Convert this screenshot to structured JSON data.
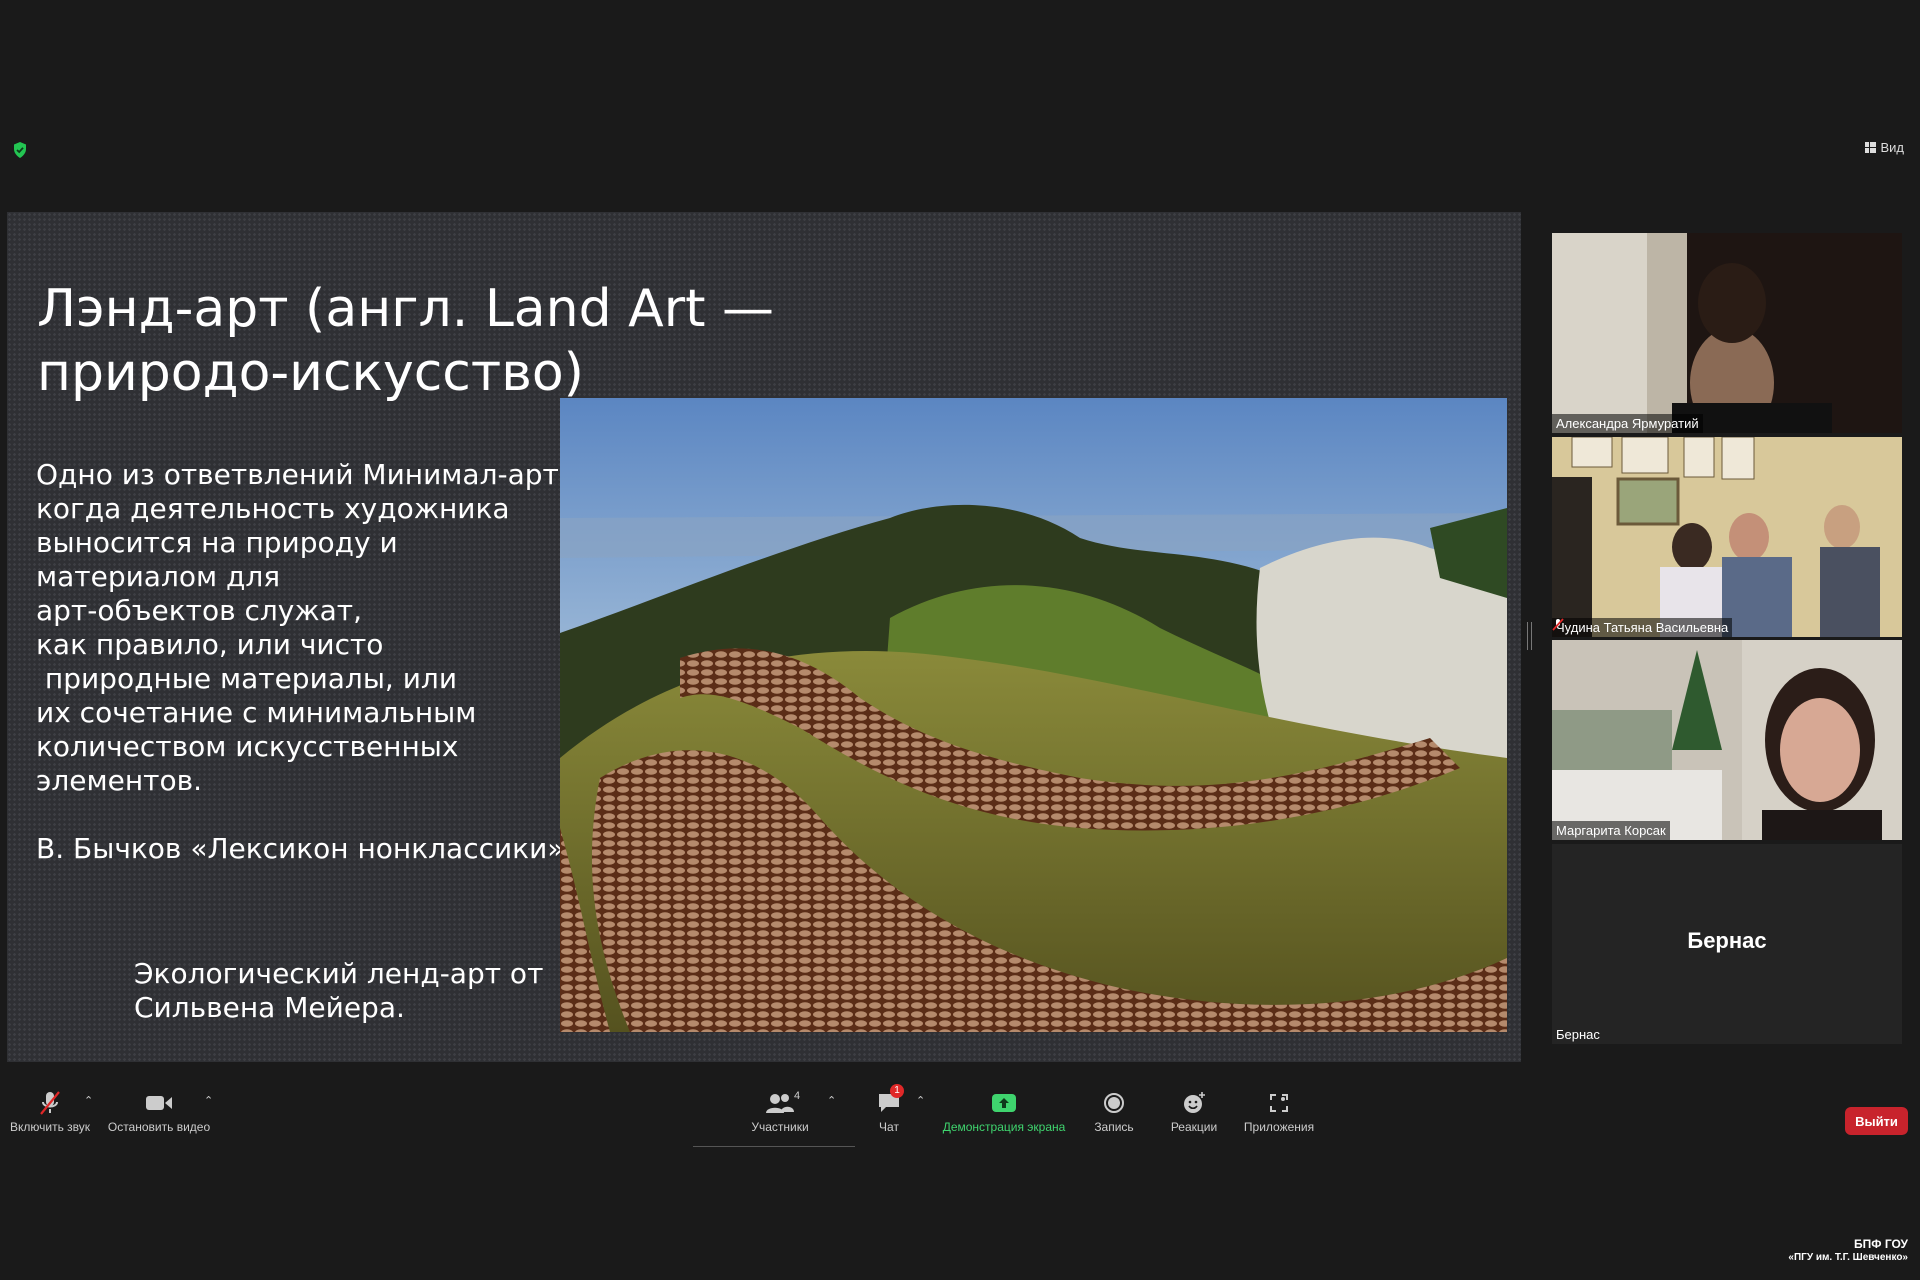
{
  "window": {
    "view_label": "Вид"
  },
  "slide": {
    "title_lines": [
      "Лэнд-арт (англ. Land Art —",
      "природо-искусство)"
    ],
    "body_lines": [
      "Одно из ответвлений Минимал-арт,",
      "когда деятельность художника",
      "выносится на природу и",
      "материалом для",
      "арт-объектов служат,",
      "как правило, или чисто",
      " природные материалы, или",
      "их сочетание с минимальным",
      "количеством искусственных",
      "элементов."
    ],
    "citation": "В. Бычков «Лексикон нонклассики»",
    "caption_lines": [
      "Экологический ленд-арт от",
      "Сильвена Мейера."
    ]
  },
  "participants": [
    {
      "name": "Александра Ярмуратий",
      "muted": false
    },
    {
      "name": "Чудина Татьяна Васильевна",
      "muted": true
    },
    {
      "name": "Маргарита Корсак",
      "muted": false,
      "active": true
    },
    {
      "name": "Бернас",
      "display": "Бернас",
      "video": false
    }
  ],
  "toolbar": {
    "mute_label": "Включить звук",
    "video_label": "Остановить видео",
    "participants_label": "Участники",
    "participants_count": "4",
    "chat_label": "Чат",
    "chat_badge": "1",
    "share_label": "Демонстрация экрана",
    "record_label": "Запись",
    "reactions_label": "Реакции",
    "apps_label": "Приложения",
    "leave_label": "Выйти"
  },
  "watermark": {
    "line1": "БПФ ГОУ",
    "line2": "«ПГУ им. Т.Г. Шевченко»"
  },
  "colors": {
    "accent_green": "#3fd46e",
    "leave_red": "#c8232c",
    "active_speaker": "#e8e43b"
  }
}
